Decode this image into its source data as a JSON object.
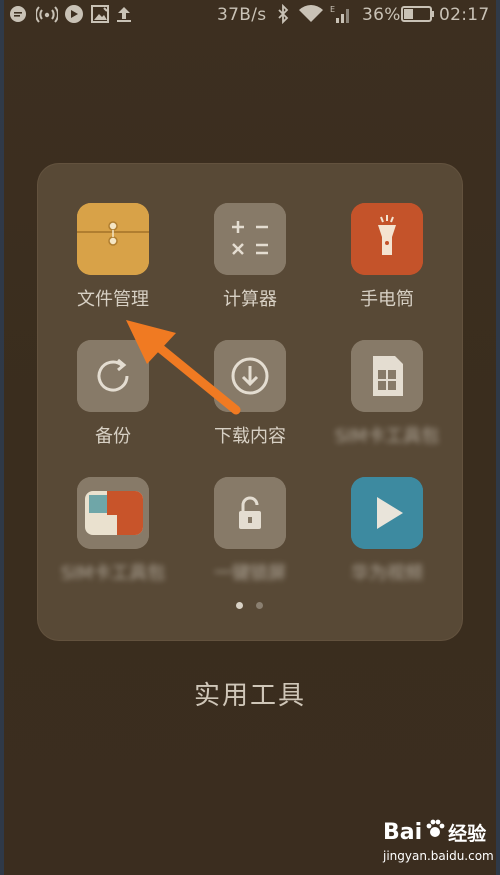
{
  "status_bar": {
    "net_speed": "37B/s",
    "battery_percent": "36%",
    "battery_level": 0.36,
    "time": "02:17",
    "left_icons": [
      "message-icon",
      "wifi-hotspot-icon",
      "location-pin-icon",
      "image-icon",
      "upload-icon"
    ],
    "right_icons": [
      "bluetooth-icon",
      "wifi-icon",
      "signal-icon",
      "battery-icon"
    ]
  },
  "folder": {
    "title": "实用工具",
    "apps": [
      {
        "label": "文件管理",
        "icon": "folder-file-icon",
        "color": "#d9a44a"
      },
      {
        "label": "计算器",
        "icon": "calculator-icon",
        "color": "#8a7c6a"
      },
      {
        "label": "手电筒",
        "icon": "flashlight-icon",
        "color": "#c8542a"
      },
      {
        "label": "备份",
        "icon": "backup-icon",
        "color": "#8a7c6a"
      },
      {
        "label": "下载内容",
        "icon": "download-icon",
        "color": "#8a7c6a"
      },
      {
        "label": "SIM卡工具包",
        "icon": "sim-card-icon",
        "color": "#8a7c6a"
      },
      {
        "label": "SIM卡工具包",
        "icon": "sim-card-color-icon",
        "color": "#c8542a"
      },
      {
        "label": "一键锁屏",
        "icon": "lock-icon",
        "color": "#8a7c6a"
      },
      {
        "label": "华为视频",
        "icon": "video-play-icon",
        "color": "#3e8aa0"
      }
    ],
    "page_count": 2,
    "current_page": 1
  },
  "annotation": {
    "arrow_color": "#f07a22"
  },
  "watermark": {
    "logo": "Bai",
    "logo2": "经验",
    "url": "jingyan.baidu.com"
  }
}
